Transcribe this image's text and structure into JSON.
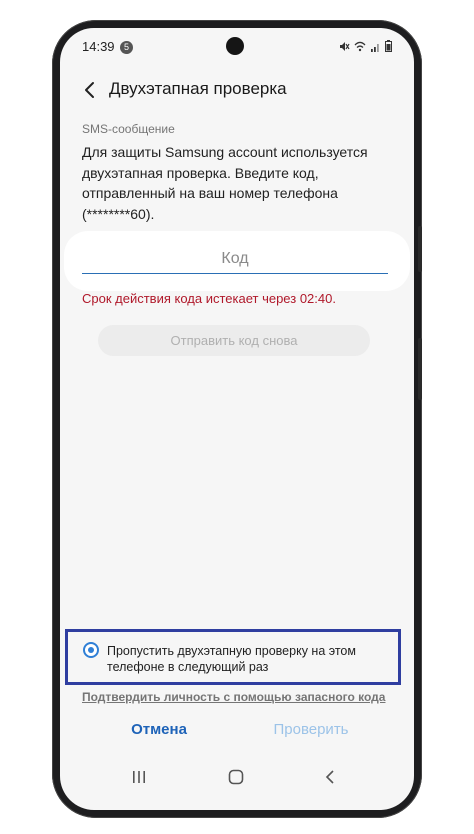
{
  "status_bar": {
    "time": "14:39",
    "notification_count": "5",
    "icons": [
      "mute-icon",
      "wifi-icon",
      "signal-icon",
      "battery-icon"
    ]
  },
  "header": {
    "back_icon": "chevron-left-icon",
    "title": "Двухэтапная проверка"
  },
  "content": {
    "section_label": "SMS-сообщение",
    "description": "Для защиты Samsung account используется двухэтапная проверка. Введите код, отправленный на ваш номер телефона (********60).",
    "code_input": {
      "placeholder": "Код",
      "value": ""
    },
    "expiry_message": "Срок действия кода истекает через 02:40.",
    "resend_button": "Отправить код снова",
    "skip_option": {
      "label": "Пропустить двухэтапную проверку на этом телефоне в следующий раз",
      "selected": true
    },
    "backup_link": "Подтвердить личность с помощью запасного кода"
  },
  "actions": {
    "cancel": "Отмена",
    "verify": "Проверить"
  },
  "nav_bar": {
    "icons": [
      "recents-icon",
      "home-icon",
      "back-icon"
    ]
  },
  "colors": {
    "accent": "#1e63b8",
    "error": "#b0182a",
    "highlight_border": "#2f3ea0"
  }
}
